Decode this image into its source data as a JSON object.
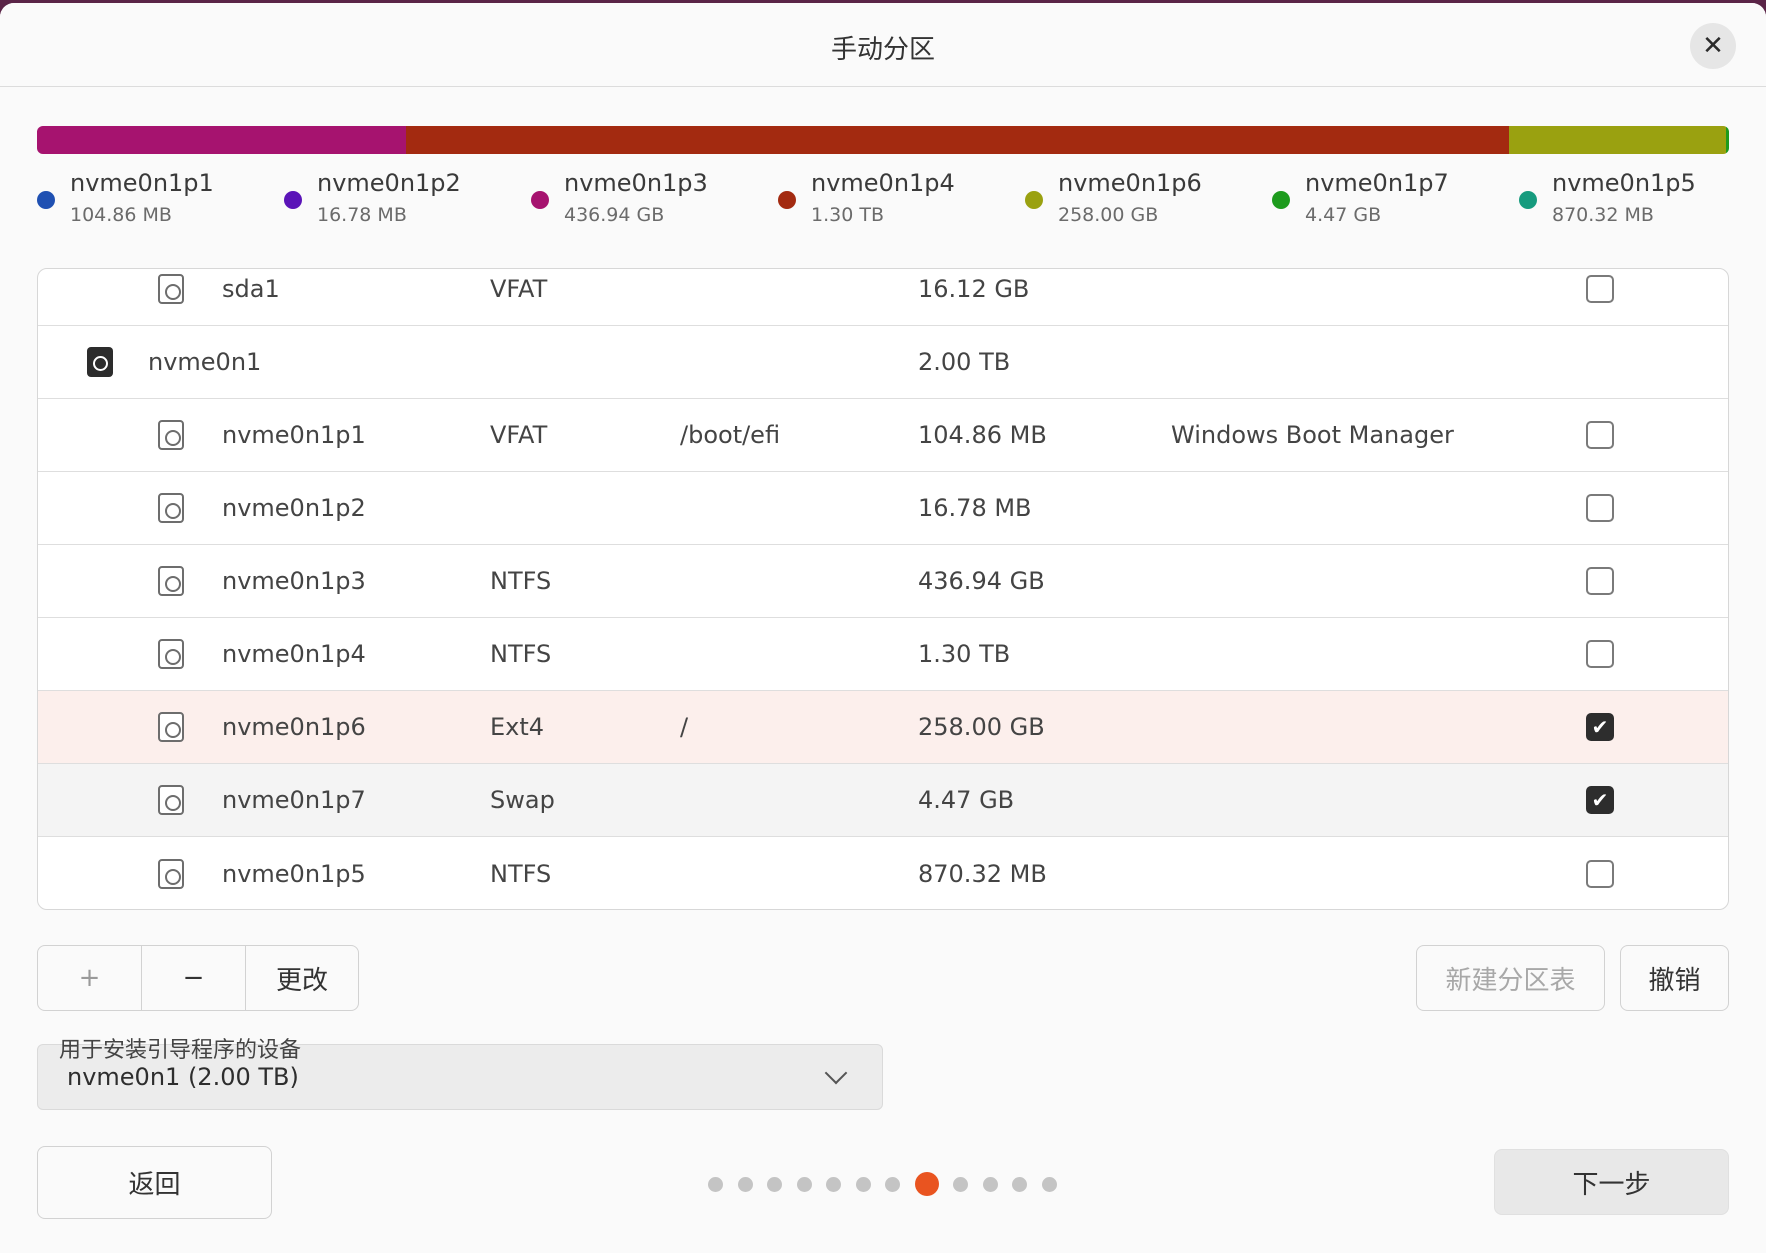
{
  "window": {
    "title": "手动分区",
    "close_icon": "✕"
  },
  "usage_bar": [
    {
      "partition": "nvme0n1p1",
      "color": "#1f50b2",
      "fraction": 0.0
    },
    {
      "partition": "nvme0n1p2",
      "color": "#5b14b8",
      "fraction": 0.0
    },
    {
      "partition": "nvme0n1p3",
      "color": "#a6136f",
      "fraction": 0.218
    },
    {
      "partition": "nvme0n1p4",
      "color": "#a32a10",
      "fraction": 0.652
    },
    {
      "partition": "nvme0n1p6",
      "color": "#9aa110",
      "fraction": 0.128
    },
    {
      "partition": "nvme0n1p7",
      "color": "#1d9b1d",
      "fraction": 0.002
    }
  ],
  "legend": [
    {
      "name": "nvme0n1p1",
      "size": "104.86 MB",
      "color": "#1f50b2"
    },
    {
      "name": "nvme0n1p2",
      "size": "16.78 MB",
      "color": "#5b14b8"
    },
    {
      "name": "nvme0n1p3",
      "size": "436.94 GB",
      "color": "#a6136f"
    },
    {
      "name": "nvme0n1p4",
      "size": "1.30 TB",
      "color": "#a32a10"
    },
    {
      "name": "nvme0n1p6",
      "size": "258.00 GB",
      "color": "#9aa110"
    },
    {
      "name": "nvme0n1p7",
      "size": "4.47 GB",
      "color": "#1d9b1d"
    },
    {
      "name": "nvme0n1p5",
      "size": "870.32 MB",
      "color": "#169b7e"
    }
  ],
  "partitions": [
    {
      "type": "partition",
      "name": "sda1",
      "fs": "VFAT",
      "mount": "",
      "size": "16.12 GB",
      "label": "",
      "checked": false,
      "state": "normal"
    },
    {
      "type": "disk",
      "name": "nvme0n1",
      "fs": "",
      "mount": "",
      "size": "2.00 TB",
      "label": "",
      "checked": null,
      "state": "normal"
    },
    {
      "type": "partition",
      "name": "nvme0n1p1",
      "fs": "VFAT",
      "mount": "/boot/efi",
      "size": "104.86 MB",
      "label": "Windows Boot Manager",
      "checked": false,
      "state": "normal"
    },
    {
      "type": "partition",
      "name": "nvme0n1p2",
      "fs": "",
      "mount": "",
      "size": "16.78 MB",
      "label": "",
      "checked": false,
      "state": "normal"
    },
    {
      "type": "partition",
      "name": "nvme0n1p3",
      "fs": "NTFS",
      "mount": "",
      "size": "436.94 GB",
      "label": "",
      "checked": false,
      "state": "normal"
    },
    {
      "type": "partition",
      "name": "nvme0n1p4",
      "fs": "NTFS",
      "mount": "",
      "size": "1.30 TB",
      "label": "",
      "checked": false,
      "state": "normal"
    },
    {
      "type": "partition",
      "name": "nvme0n1p6",
      "fs": "Ext4",
      "mount": "/",
      "size": "258.00 GB",
      "label": "",
      "checked": true,
      "state": "selected"
    },
    {
      "type": "partition",
      "name": "nvme0n1p7",
      "fs": "Swap",
      "mount": "",
      "size": "4.47 GB",
      "label": "",
      "checked": true,
      "state": "hover"
    },
    {
      "type": "partition",
      "name": "nvme0n1p5",
      "fs": "NTFS",
      "mount": "",
      "size": "870.32 MB",
      "label": "",
      "checked": false,
      "state": "normal"
    }
  ],
  "toolbar": {
    "add_label": "+",
    "remove_label": "−",
    "change_label": "更改",
    "new_table_label": "新建分区表",
    "revert_label": "撤销"
  },
  "bootloader": {
    "label": "用于安装引导程序的设备",
    "value": "nvme0n1  (2.00 TB)"
  },
  "footer": {
    "back_label": "返回",
    "next_label": "下一步",
    "page_count": 12,
    "current_page": 8
  },
  "colors": {
    "accent": "#e95420",
    "selected_row": "#fcefec"
  }
}
